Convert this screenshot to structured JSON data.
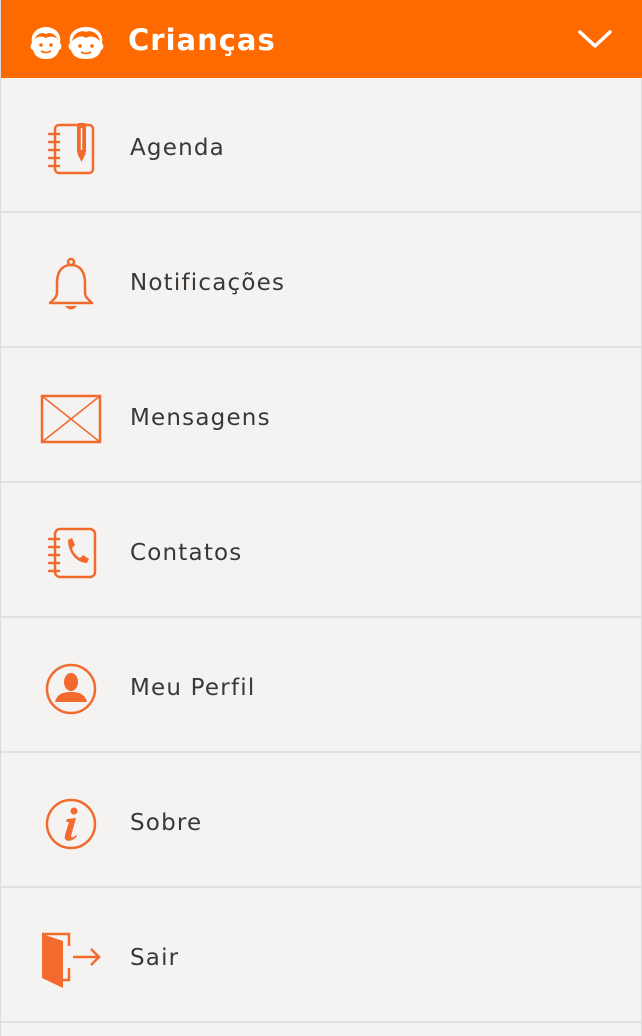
{
  "header": {
    "title": "Crianças",
    "logo_icon": "kids-faces-icon",
    "toggle_icon": "chevron-down-icon",
    "background": "#ff6a00"
  },
  "menu": {
    "accent_color": "#f26a2e",
    "items": [
      {
        "label": "Agenda",
        "icon": "notebook-pen-icon"
      },
      {
        "label": "Notificações",
        "icon": "bell-icon"
      },
      {
        "label": "Mensagens",
        "icon": "envelope-icon"
      },
      {
        "label": "Contatos",
        "icon": "phonebook-icon"
      },
      {
        "label": "Meu Perfil",
        "icon": "user-profile-icon"
      },
      {
        "label": "Sobre",
        "icon": "info-icon"
      },
      {
        "label": "Sair",
        "icon": "exit-door-icon"
      }
    ]
  }
}
